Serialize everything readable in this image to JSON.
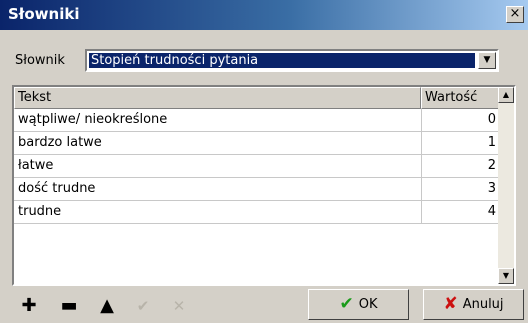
{
  "window": {
    "title": "Słowniki",
    "close_glyph": "×"
  },
  "dictionary": {
    "label": "Słownik",
    "selected": "Stopień trudności pytania"
  },
  "grid": {
    "columns": [
      "Tekst",
      "Wartość"
    ],
    "rows": [
      {
        "text": "wątpliwe/ nieokreślone",
        "value": "0"
      },
      {
        "text": "bardzo latwe",
        "value": "1"
      },
      {
        "text": "łatwe",
        "value": "2"
      },
      {
        "text": "dość trudne",
        "value": "3"
      },
      {
        "text": "trudne",
        "value": "4"
      }
    ]
  },
  "toolbar": {
    "icons": [
      "plus-icon",
      "minus-icon",
      "up-arrow-icon",
      "check-icon",
      "cross-icon"
    ],
    "glyphs": [
      "✚",
      "▬",
      "▲",
      "✔",
      "✕"
    ]
  },
  "buttons": {
    "ok_label": "OK",
    "ok_icon": "✔",
    "ok_icon_color": "#1a9b1a",
    "cancel_label": "Anuluj",
    "cancel_icon": "✘",
    "cancel_icon_color": "#cc1010"
  }
}
